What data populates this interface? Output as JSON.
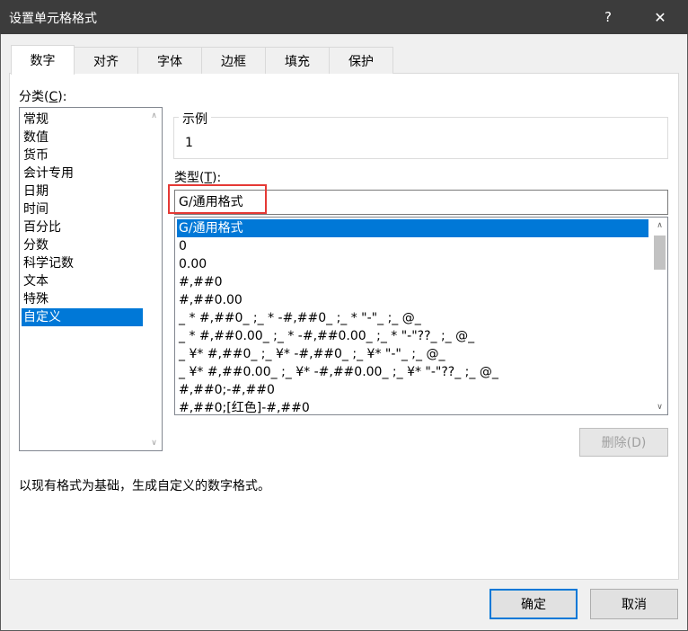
{
  "window": {
    "title": "设置单元格格式",
    "help_glyph": "?",
    "close_glyph": "✕"
  },
  "tabs": [
    {
      "label": "数字",
      "active": true
    },
    {
      "label": "对齐"
    },
    {
      "label": "字体"
    },
    {
      "label": "边框"
    },
    {
      "label": "填充"
    },
    {
      "label": "保护"
    }
  ],
  "category": {
    "label_text": "分类(",
    "label_key": "C",
    "label_end": "):",
    "items": [
      "常规",
      "数值",
      "货币",
      "会计专用",
      "日期",
      "时间",
      "百分比",
      "分数",
      "科学记数",
      "文本",
      "特殊",
      "自定义"
    ],
    "selected": "自定义"
  },
  "sample": {
    "title": "示例",
    "value": "1"
  },
  "type": {
    "label_text": "类型(",
    "label_key": "T",
    "label_end": "):",
    "value": "G/通用格式"
  },
  "formats": {
    "items": [
      "G/通用格式",
      "0",
      "0.00",
      "#,##0",
      "#,##0.00",
      "_ * #,##0_ ;_ * -#,##0_ ;_ * \"-\"_ ;_ @_",
      "_ * #,##0.00_ ;_ * -#,##0.00_ ;_ * \"-\"??_ ;_ @_",
      "_ ¥* #,##0_ ;_ ¥* -#,##0_ ;_ ¥* \"-\"_ ;_ @_",
      "_ ¥* #,##0.00_ ;_ ¥* -#,##0.00_ ;_ ¥* \"-\"??_ ;_ @_",
      "#,##0;-#,##0",
      "#,##0;[红色]-#,##0"
    ],
    "selected": "G/通用格式"
  },
  "delete_button": "删除(D)",
  "description": "以现有格式为基础，生成自定义的数字格式。",
  "ok_button": "确定",
  "cancel_button": "取消",
  "icons": {
    "scroll_up": "∧",
    "scroll_down": "∨"
  }
}
